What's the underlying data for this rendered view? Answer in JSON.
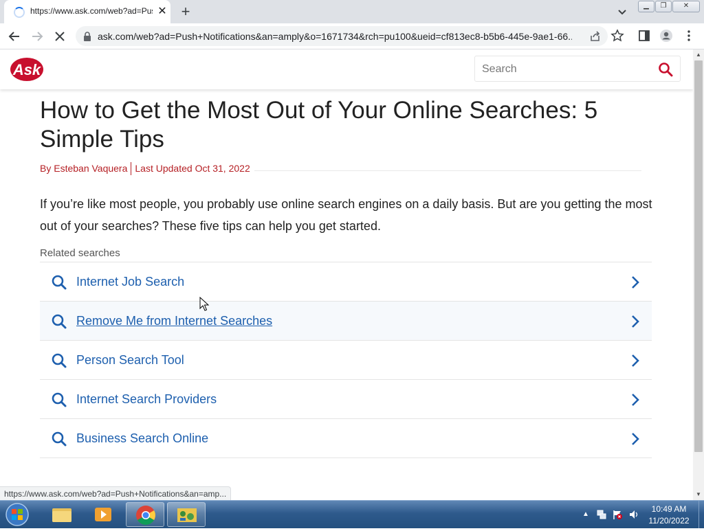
{
  "browser": {
    "tab": {
      "title": "https://www.ask.com/web?ad=Push",
      "close_label": "✕"
    },
    "new_tab_label": "+",
    "url": "ask.com/web?ad=Push+Notifications&an=amply&o=1671734&rch=pu100&ueid=cf813ec8-b5b6-445e-9ae1-66...",
    "status_url": "https://www.ask.com/web?ad=Push+Notifications&an=amp..."
  },
  "site": {
    "logo_text": "Ask",
    "search_placeholder": "Search",
    "brand_color": "#c8102e"
  },
  "article": {
    "title": "How to Get the Most Out of Your Online Searches: 5 Simple Tips",
    "author": "By Esteban Vaquera",
    "updated": "Last Updated Oct 31, 2022",
    "intro": "If you’re like most people, you probably use online search engines on a daily basis. But are you getting the most out of your searches? These five tips can help you get started."
  },
  "related": {
    "label": "Related searches",
    "items": [
      {
        "text": "Internet Job Search"
      },
      {
        "text": "Remove Me from Internet Searches"
      },
      {
        "text": "Person Search Tool"
      },
      {
        "text": "Internet Search Providers"
      },
      {
        "text": "Business Search Online"
      }
    ],
    "link_color": "#1d5fae"
  },
  "taskbar": {
    "time": "10:49 AM",
    "date": "11/20/2022"
  }
}
